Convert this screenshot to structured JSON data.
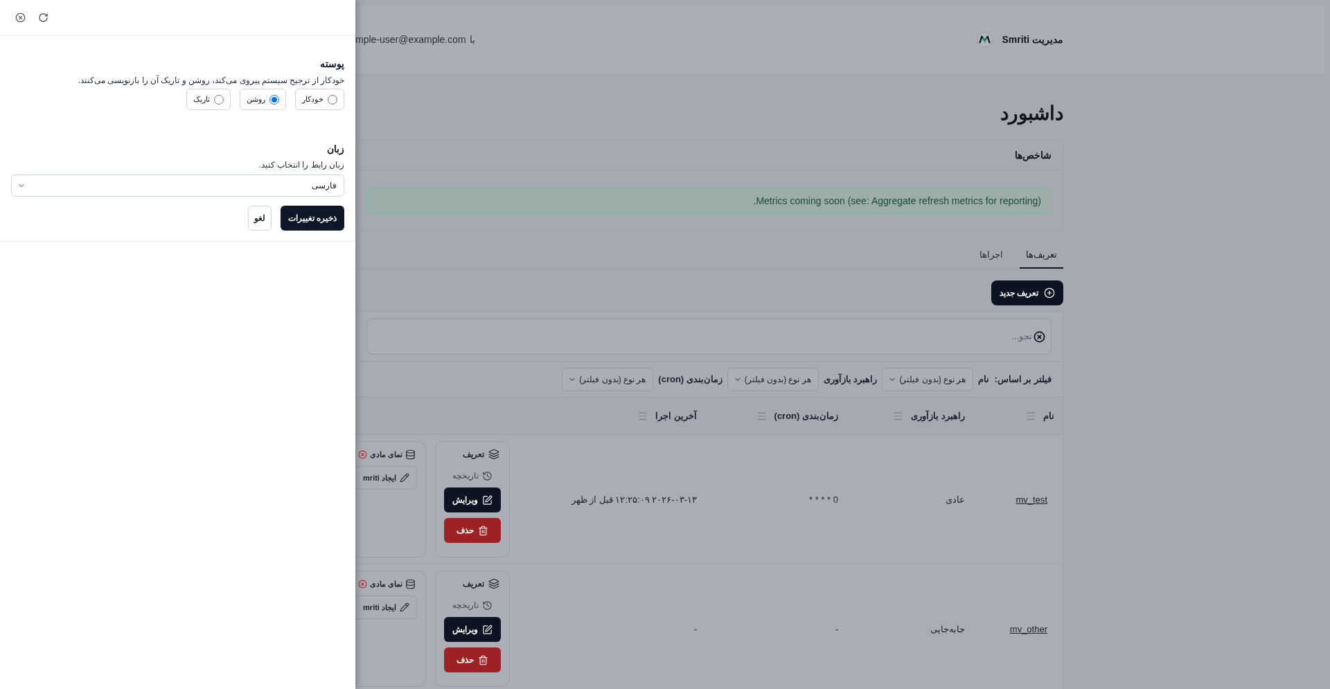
{
  "settings_panel": {
    "appearance": {
      "title": "پوسته",
      "description": "خودکار از ترجیح سیستم پیروی می‌کند، روشن و تاریک آن را بازنویسی می‌کنند.",
      "options": [
        {
          "label": "خودکار",
          "selected": false
        },
        {
          "label": "روشن",
          "selected": true
        },
        {
          "label": "تاریک",
          "selected": false
        }
      ]
    },
    "language": {
      "title": "زبان",
      "description": "زبان رابط را انتخاب کنید.",
      "value": "فارسی"
    },
    "buttons": [
      {
        "label": "ذخیره تغییرات",
        "kind": "primary"
      },
      {
        "label": "لغو",
        "kind": "outline"
      }
    ]
  },
  "header": {
    "brand": "مدیریت Smriti",
    "user_prefix": "با",
    "user_email": "mple-user@example.com"
  },
  "page_title": "داشبورد",
  "metrics_card": {
    "title": "شاخص‌ها",
    "alert": "Metrics coming soon (see: Aggregate refresh metrics for reporting)."
  },
  "tabs": [
    {
      "label": "تعریف‌ها",
      "selected": true
    },
    {
      "label": "اجراها",
      "selected": false
    }
  ],
  "new_button": {
    "label": "تعریف جدید"
  },
  "search": {
    "placeholder": "تجو..."
  },
  "filters": {
    "label": "فیلتر بر اساس:",
    "items": [
      {
        "label": "نام",
        "value": "هر نوع (بدون فیلتر)"
      },
      {
        "label": "راهبرد بازآوری",
        "value": "هر نوع (بدون فیلتر)"
      },
      {
        "label": "زمان‌بندی (cron)",
        "value": "هر نوع (بدون فیلتر)"
      }
    ]
  },
  "table": {
    "columns": [
      "نام",
      "راهبرد بازآوری",
      "زمان‌بندی (cron)",
      "آخرین اجرا"
    ],
    "rows": [
      {
        "name": "mv_test",
        "strategy": "عادی",
        "schedule": "0 * * * *",
        "last_run": "۲۰۲۶-۰۳-۱۳ ۱۲:۲۵:۰۹ قبل از ظهر",
        "definition_card": {
          "title": "تعریف",
          "history": "تاریخچه",
          "edit": "ویرایش",
          "delete": "حذف"
        },
        "view_card": {
          "title": "نمای مادی",
          "exists": false,
          "create": "ایجاد mriti"
        }
      },
      {
        "name": "mv_other",
        "strategy": "جابه‌جایی",
        "schedule": "-",
        "last_run": "-",
        "definition_card": {
          "title": "تعریف",
          "history": "تاریخچه",
          "edit": "ویرایش",
          "delete": "حذف"
        },
        "view_card": {
          "title": "نمای مادی",
          "exists": false,
          "create": "ایجاد mriti"
        }
      }
    ]
  }
}
